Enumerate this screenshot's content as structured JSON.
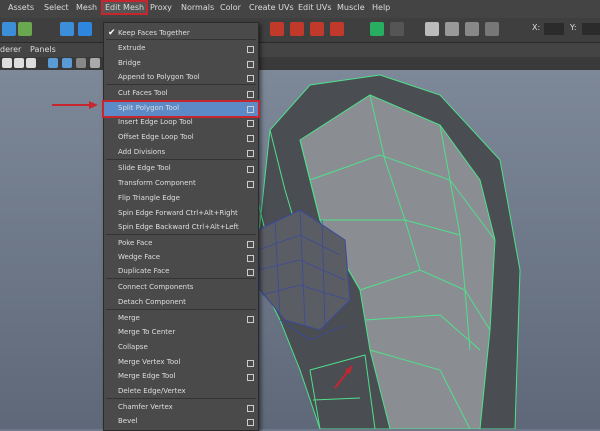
{
  "menubar": {
    "items": [
      "Assets",
      "Select",
      "Mesh",
      "Edit Mesh",
      "Proxy",
      "Normals",
      "Color",
      "Create UVs",
      "Edit UVs",
      "Muscle",
      "Help"
    ],
    "active": "Edit Mesh"
  },
  "subbar": {
    "items": [
      "derer",
      "Panels"
    ]
  },
  "toolbar": {
    "x_label": "X:",
    "y_label": "Y:"
  },
  "edit_mesh_menu": {
    "items": [
      {
        "label": "Keep Faces Together",
        "checked": true,
        "option": false
      },
      {
        "label": "Extrude",
        "option": true
      },
      {
        "label": "Bridge",
        "option": true
      },
      {
        "label": "Append to Polygon Tool",
        "option": true
      },
      {
        "label": "Cut Faces Tool",
        "option": true
      },
      {
        "label": "Split Polygon Tool",
        "option": true,
        "highlighted": true
      },
      {
        "label": "Insert Edge Loop Tool",
        "option": true
      },
      {
        "label": "Offset Edge Loop Tool",
        "option": true
      },
      {
        "label": "Add Divisions",
        "option": true
      },
      {
        "label": "Slide Edge Tool",
        "option": true
      },
      {
        "label": "Transform Component",
        "option": true
      },
      {
        "label": "Flip Triangle Edge",
        "option": false
      },
      {
        "label": "Spin Edge Forward  Ctrl+Alt+Right",
        "option": false
      },
      {
        "label": "Spin Edge Backward  Ctrl+Alt+Left",
        "option": false
      },
      {
        "label": "Poke Face",
        "option": true
      },
      {
        "label": "Wedge Face",
        "option": true
      },
      {
        "label": "Duplicate Face",
        "option": true
      },
      {
        "label": "Connect Components",
        "option": false
      },
      {
        "label": "Detach Component",
        "option": false
      },
      {
        "label": "Merge",
        "option": true
      },
      {
        "label": "Merge To Center",
        "option": false
      },
      {
        "label": "Collapse",
        "option": false
      },
      {
        "label": "Merge Vertex Tool",
        "option": true
      },
      {
        "label": "Merge Edge Tool",
        "option": true
      },
      {
        "label": "Delete Edge/Vertex",
        "option": false
      },
      {
        "label": "Chamfer Vertex",
        "option": true
      },
      {
        "label": "Bevel",
        "option": true
      }
    ]
  },
  "colors": {
    "highlight": "#5b8ac7",
    "annotation": "#c8262f",
    "mesh_edge": "#4fe08a"
  }
}
